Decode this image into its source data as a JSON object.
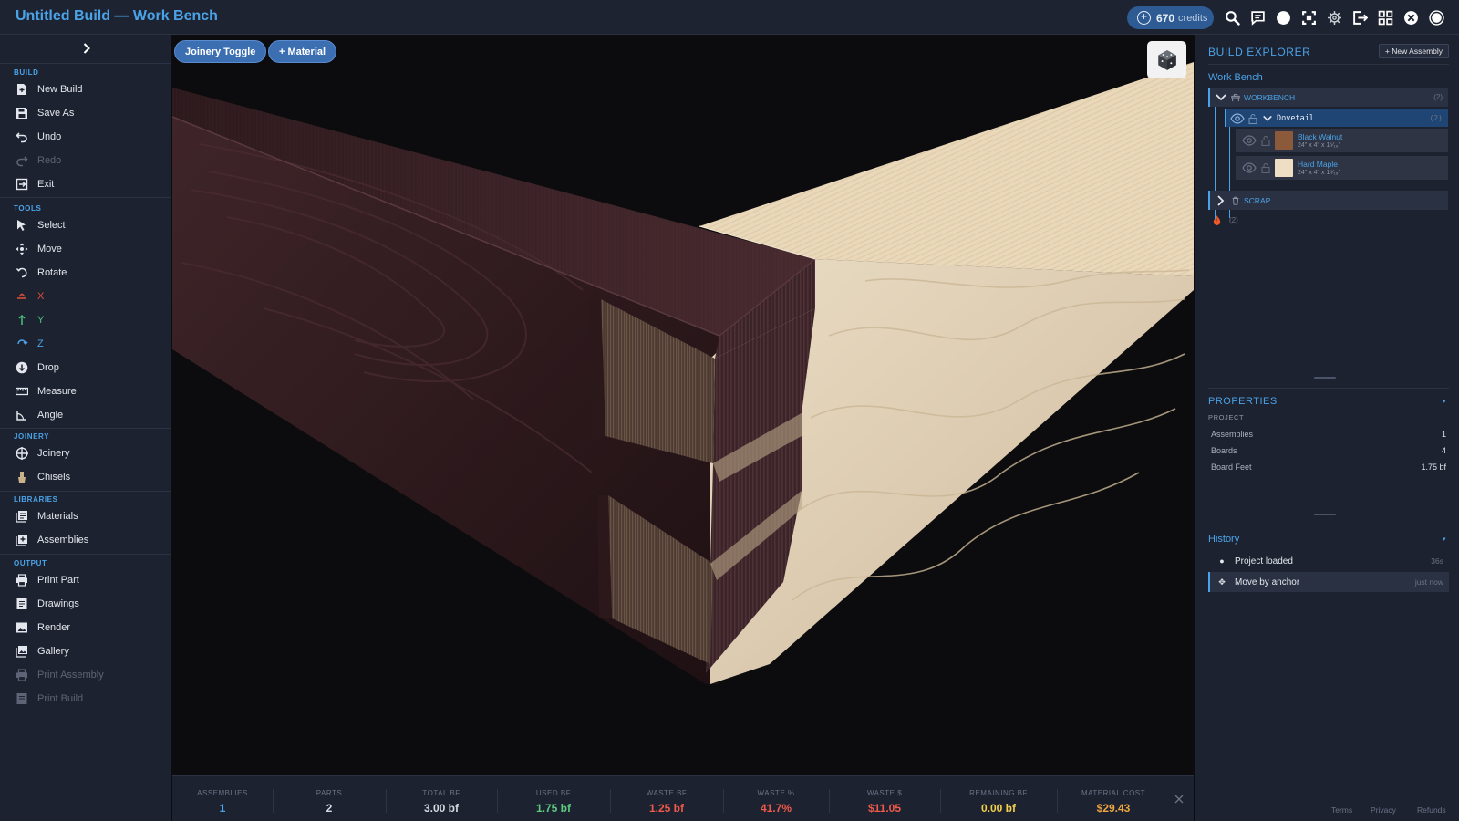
{
  "app": {
    "title": "Untitled Build — Work Bench"
  },
  "topbar": {
    "credits_value": "670",
    "credits_label": "credits",
    "icons": [
      "search-icon",
      "chat-icon",
      "circle-icon",
      "frame-icon",
      "gear-icon",
      "exit-icon",
      "grid-icon",
      "close-circle-icon",
      "user-avatar-icon"
    ]
  },
  "sidebar": {
    "sections": {
      "build": "BUILD",
      "tools": "TOOLS",
      "joinery": "JOINERY",
      "libraries": "LIBRARIES",
      "output": "OUTPUT"
    },
    "build": [
      {
        "label": "New Build",
        "icon": "new-file-icon"
      },
      {
        "label": "Save As",
        "icon": "save-icon"
      },
      {
        "label": "Undo",
        "icon": "undo-icon"
      },
      {
        "label": "Redo",
        "icon": "redo-icon",
        "disabled": true
      },
      {
        "label": "Exit",
        "icon": "exit-icon"
      }
    ],
    "tools": [
      {
        "label": "Select",
        "icon": "cursor-icon"
      },
      {
        "label": "Move",
        "icon": "move-icon"
      },
      {
        "label": "Rotate",
        "icon": "rotate-icon"
      },
      {
        "label": "X",
        "icon": "axis-x-icon",
        "color": "#e0503c"
      },
      {
        "label": "Y",
        "icon": "axis-y-icon",
        "color": "#4cc17a"
      },
      {
        "label": "Z",
        "icon": "axis-z-icon",
        "color": "#4aa3e8"
      },
      {
        "label": "Drop",
        "icon": "drop-icon"
      },
      {
        "label": "Measure",
        "icon": "ruler-icon"
      },
      {
        "label": "Angle",
        "icon": "angle-icon"
      }
    ],
    "joinery": [
      {
        "label": "Joinery",
        "icon": "joinery-icon"
      },
      {
        "label": "Chisels",
        "icon": "chisel-icon"
      }
    ],
    "libraries": [
      {
        "label": "Materials",
        "icon": "materials-icon"
      },
      {
        "label": "Assemblies",
        "icon": "assemblies-icon"
      }
    ],
    "output": [
      {
        "label": "Print Part",
        "icon": "printer-icon"
      },
      {
        "label": "Drawings",
        "icon": "drawings-icon"
      },
      {
        "label": "Render",
        "icon": "image-icon"
      },
      {
        "label": "Gallery",
        "icon": "gallery-icon"
      },
      {
        "label": "Print Assembly",
        "icon": "printer-icon",
        "disabled": true
      },
      {
        "label": "Print Build",
        "icon": "document-icon",
        "disabled": true
      }
    ]
  },
  "viewport": {
    "joinery_toggle": "Joinery Toggle",
    "add_material": "+ Material"
  },
  "stats": [
    {
      "label": "ASSEMBLIES",
      "value": "1",
      "color": "#4aa3e8"
    },
    {
      "label": "PARTS",
      "value": "2",
      "color": "#d6dae2"
    },
    {
      "label": "TOTAL BF",
      "value": "3.00 bf",
      "color": "#d6dae2"
    },
    {
      "label": "USED BF",
      "value": "1.75 bf",
      "color": "#5cc97f"
    },
    {
      "label": "WASTE BF",
      "value": "1.25 bf",
      "color": "#ee5a4a"
    },
    {
      "label": "WASTE %",
      "value": "41.7%",
      "color": "#ee5a4a"
    },
    {
      "label": "WASTE $",
      "value": "$11.05",
      "color": "#ee5a4a"
    },
    {
      "label": "REMAINING BF",
      "value": "0.00 bf",
      "color": "#f2d04b"
    },
    {
      "label": "MATERIAL COST",
      "value": "$29.43",
      "color": "#f0a640"
    }
  ],
  "explorer": {
    "title": "BUILD EXPLORER",
    "new_assembly": "+ New Assembly",
    "project_name": "Work Bench",
    "workbench_label": "WORKBENCH",
    "workbench_count": "(2)",
    "dovetail_label": "Dovetail",
    "dovetail_count": "(2)",
    "materials": [
      {
        "name": "Black Walnut",
        "dims": "24\" x 4\" x 1⁵⁄₁₆\"",
        "swatch": "#8a5a3b"
      },
      {
        "name": "Hard Maple",
        "dims": "24\" x 4\" x 1⁵⁄₁₆\"",
        "swatch": "#eedfc4"
      }
    ],
    "scrap_label": "SCRAP",
    "scrap_count": "(2)"
  },
  "properties": {
    "title": "PROPERTIES",
    "caret": "▾",
    "subheading": "PROJECT",
    "rows": [
      {
        "label": "Assemblies",
        "value": "1"
      },
      {
        "label": "Boards",
        "value": "4"
      },
      {
        "label": "Board Feet",
        "value": "1.75 bf"
      }
    ]
  },
  "history": {
    "title": "History",
    "caret": "▾",
    "items": [
      {
        "label": "Project loaded",
        "time": "36s",
        "icon": "dot-icon"
      },
      {
        "label": "Move by anchor",
        "time": "just now",
        "icon": "move-icon"
      }
    ]
  },
  "footer": {
    "terms": "Terms",
    "privacy": "Privacy",
    "refunds": "Refunds"
  },
  "colors": {
    "accent": "#4aa3e8",
    "walnut": "#3a2326",
    "maple": "#e6d4b6"
  }
}
